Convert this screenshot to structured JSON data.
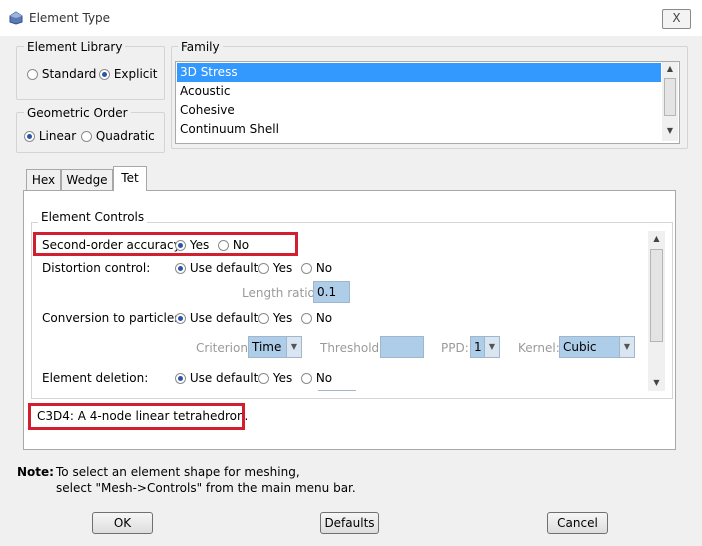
{
  "window": {
    "title": "Element Type",
    "close_label": "X"
  },
  "element_library": {
    "label": "Element Library",
    "options": [
      {
        "label": "Standard",
        "selected": false
      },
      {
        "label": "Explicit",
        "selected": true
      }
    ]
  },
  "geometric_order": {
    "label": "Geometric Order",
    "options": [
      {
        "label": "Linear",
        "selected": true
      },
      {
        "label": "Quadratic",
        "selected": false
      }
    ]
  },
  "family": {
    "label": "Family",
    "items": [
      "3D Stress",
      "Acoustic",
      "Cohesive",
      "Continuum Shell"
    ],
    "selected_index": 0
  },
  "tabs": [
    {
      "label": "Hex",
      "active": false
    },
    {
      "label": "Wedge",
      "active": false
    },
    {
      "label": "Tet",
      "active": true
    }
  ],
  "element_controls": {
    "label": "Element Controls",
    "second_order": {
      "label": "Second-order accuracy:",
      "options": [
        "Yes",
        "No"
      ],
      "selected": "Yes"
    },
    "distortion": {
      "label": "Distortion control:",
      "options": [
        "Use default",
        "Yes",
        "No"
      ],
      "selected": "Use default"
    },
    "length_ratio": {
      "label": "Length ratio:",
      "value": "0.1"
    },
    "conversion": {
      "label": "Conversion to particles:",
      "options": [
        "Use default",
        "Yes",
        "No"
      ],
      "selected": "Use default"
    },
    "criterion": {
      "label": "Criterion:",
      "value": "Time"
    },
    "threshold": {
      "label": "Threshold:",
      "value": ""
    },
    "ppd": {
      "label": "PPD:",
      "value": "1"
    },
    "kernel": {
      "label": "Kernel:",
      "value": "Cubic"
    },
    "deletion": {
      "label": "Element deletion:",
      "options": [
        "Use default",
        "Yes",
        "No"
      ],
      "selected": "Use default"
    }
  },
  "description": "C3D4:  A 4-node linear tetrahedron.",
  "note": {
    "label": "Note:",
    "line1": "To select an element shape for meshing,",
    "line2": "select \"Mesh->Controls\" from the main menu bar."
  },
  "buttons": {
    "ok": "OK",
    "defaults": "Defaults",
    "cancel": "Cancel"
  },
  "colors": {
    "accent": "#3399ff",
    "highlight": "#d21f2f",
    "field": "#aecde8"
  }
}
